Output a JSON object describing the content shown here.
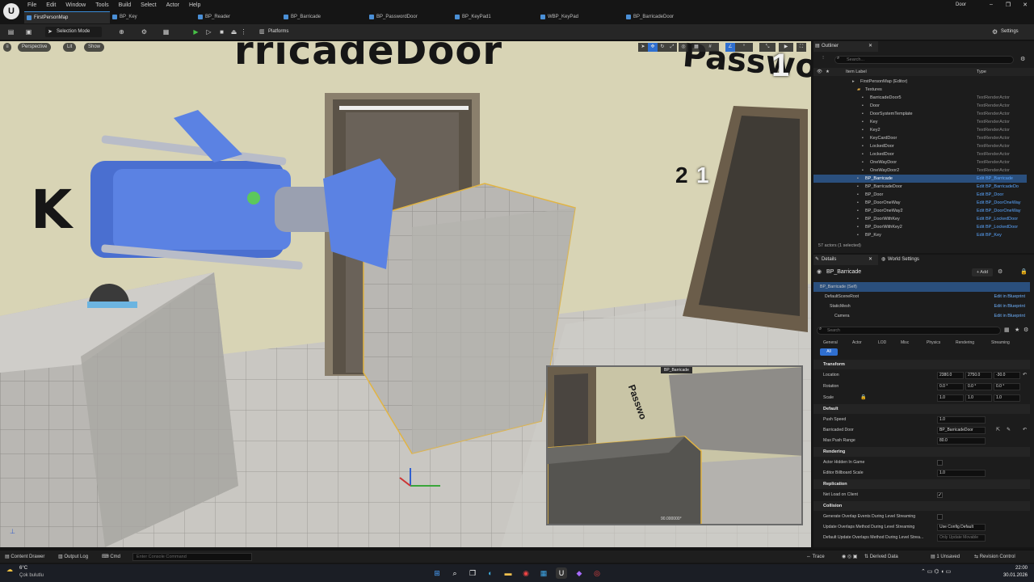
{
  "window": {
    "project_name": "Door",
    "minimize": "–",
    "maximize": "❐",
    "close": "✕"
  },
  "menu": [
    "File",
    "Edit",
    "Window",
    "Tools",
    "Build",
    "Select",
    "Actor",
    "Help"
  ],
  "tabs": [
    {
      "label": "FirstPersonMap",
      "active": true
    },
    {
      "label": "BP_Key",
      "active": false
    },
    {
      "label": "BP_Reader",
      "active": false
    },
    {
      "label": "BP_Barricade",
      "active": false
    },
    {
      "label": "BP_PasswordDoor",
      "active": false
    },
    {
      "label": "BP_KeyPad1",
      "active": false
    },
    {
      "label": "WBP_KeyPad",
      "active": false
    },
    {
      "label": "BP_BarricadeDoor",
      "active": false
    }
  ],
  "toolbar": {
    "selection_mode": "Selection Mode",
    "platforms": "Platforms",
    "settings": "Settings"
  },
  "viewport": {
    "perspective": "Perspective",
    "lit": "Lit",
    "show": "Show",
    "sign_barricade": "rricadeDoor",
    "sign_password": "Passwo",
    "sign_k": "K",
    "num_1": "1",
    "num_2": "2",
    "preview_title": "BP_Barricade",
    "preview_value": "90.000000°",
    "preview_sign": "Passwo"
  },
  "outliner": {
    "tab": "Outliner",
    "search_placeholder": "Search...",
    "col_label": "Item Label",
    "col_type": "Type",
    "rows": [
      {
        "name": "FirstPersonMap (Editor)",
        "type": "",
        "indent": 0,
        "selected": false,
        "bp": false
      },
      {
        "name": "Textures",
        "type": "",
        "indent": 1,
        "selected": false,
        "bp": false
      },
      {
        "name": "BarricadeDoor5",
        "type": "TextRenderActor",
        "indent": 2,
        "selected": false,
        "bp": false
      },
      {
        "name": "Door",
        "type": "TextRenderActor",
        "indent": 2,
        "selected": false,
        "bp": false
      },
      {
        "name": "DoorSystemTemplate",
        "type": "TextRenderActor",
        "indent": 2,
        "selected": false,
        "bp": false
      },
      {
        "name": "Key",
        "type": "TextRenderActor",
        "indent": 2,
        "selected": false,
        "bp": false
      },
      {
        "name": "Key2",
        "type": "TextRenderActor",
        "indent": 2,
        "selected": false,
        "bp": false
      },
      {
        "name": "KeyCardDoor",
        "type": "TextRenderActor",
        "indent": 2,
        "selected": false,
        "bp": false
      },
      {
        "name": "LockedDoor",
        "type": "TextRenderActor",
        "indent": 2,
        "selected": false,
        "bp": false
      },
      {
        "name": "LockedDoor",
        "type": "TextRenderActor",
        "indent": 2,
        "selected": false,
        "bp": false
      },
      {
        "name": "OneWayDoor",
        "type": "TextRenderActor",
        "indent": 2,
        "selected": false,
        "bp": false
      },
      {
        "name": "OneWayDoor2",
        "type": "TextRenderActor",
        "indent": 2,
        "selected": false,
        "bp": false
      },
      {
        "name": "BP_Barricade",
        "type": "Edit BP_Barricade",
        "indent": 1,
        "selected": true,
        "bp": true
      },
      {
        "name": "BP_BarricadeDoor",
        "type": "Edit BP_BarricadeDo",
        "indent": 1,
        "selected": false,
        "bp": true
      },
      {
        "name": "BP_Door",
        "type": "Edit BP_Door",
        "indent": 1,
        "selected": false,
        "bp": true
      },
      {
        "name": "BP_DoorOneWay",
        "type": "Edit BP_DoorOneWay",
        "indent": 1,
        "selected": false,
        "bp": true
      },
      {
        "name": "BP_DoorOneWay2",
        "type": "Edit BP_DoorOneWay",
        "indent": 1,
        "selected": false,
        "bp": true
      },
      {
        "name": "BP_DoorWithKey",
        "type": "Edit BP_LockedDoor",
        "indent": 1,
        "selected": false,
        "bp": true
      },
      {
        "name": "BP_DoorWithKey2",
        "type": "Edit BP_LockedDoor",
        "indent": 1,
        "selected": false,
        "bp": true
      },
      {
        "name": "BP_Key",
        "type": "Edit BP_Key",
        "indent": 1,
        "selected": false,
        "bp": true
      }
    ],
    "count": "57 actors (1 selected)"
  },
  "details": {
    "tab": "Details",
    "tab2": "World Settings",
    "actor_name": "BP_Barricade",
    "add": "+ Add",
    "components": [
      {
        "name": "BP_Barricade (Self)",
        "link": "",
        "indent": 0
      },
      {
        "name": "DefaultSceneRoot",
        "link": "Edit in Blueprint",
        "indent": 1
      },
      {
        "name": "StaticMesh",
        "link": "Edit in Blueprint",
        "indent": 2
      },
      {
        "name": "Camera",
        "link": "Edit in Blueprint",
        "indent": 3
      }
    ],
    "search_placeholder": "Search",
    "categories": [
      "General",
      "Actor",
      "LOD",
      "Misc",
      "Physics",
      "Rendering",
      "Streaming"
    ],
    "all": "All",
    "transform": "Transform",
    "location": {
      "label": "Location",
      "x": "2380.0",
      "y": "2750.0",
      "z": "-30.0"
    },
    "rotation": {
      "label": "Rotation",
      "x": "0.0 °",
      "y": "0.0 °",
      "z": "0.0 °"
    },
    "scale": {
      "label": "Scale",
      "x": "1.0",
      "y": "1.0",
      "z": "1.0"
    },
    "default": "Default",
    "push_speed": {
      "label": "Push Speed",
      "value": "1.0"
    },
    "barricaded_door": {
      "label": "Barricaded Door",
      "value": "BP_BarricadeDoor"
    },
    "max_push_range": {
      "label": "Max Push Range",
      "value": "80.0"
    },
    "rendering": "Rendering",
    "actor_hidden": {
      "label": "Actor Hidden In Game"
    },
    "editor_billboard": {
      "label": "Editor Billboard Scale",
      "value": "1.0"
    },
    "replication": "Replication",
    "net_load": {
      "label": "Net Load on Client"
    },
    "collision": "Collision",
    "gen_overlap": {
      "label": "Generate Overlap Events During Level Streaming"
    },
    "update_overlaps": {
      "label": "Update Overlaps Method During Level Streaming",
      "value": "Use Config Default"
    },
    "default_update": {
      "label": "Default Update Overlaps Method During Level Strea...",
      "value": "Only Update Movable"
    }
  },
  "statusbar": {
    "content_drawer": "Content Drawer",
    "output_log": "Output Log",
    "cmd": "Cmd",
    "console_placeholder": "Enter Console Command",
    "trace": "Trace",
    "derived_data": "Derived Data",
    "unsaved": "1 Unsaved",
    "revision_control": "Revision Control"
  },
  "taskbar": {
    "temp": "6°C",
    "weather": "Çok bulutlu",
    "time": "22:00",
    "date": "30.01.2026"
  }
}
